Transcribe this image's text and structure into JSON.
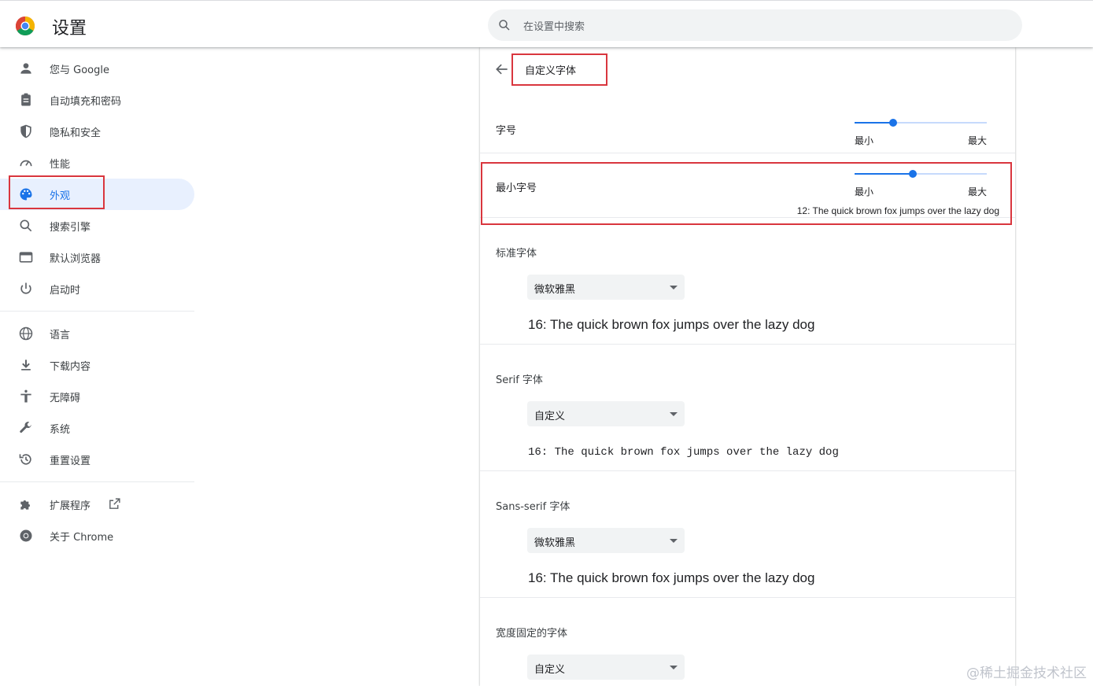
{
  "header": {
    "title": "设置",
    "search_placeholder": "在设置中搜索"
  },
  "sidebar": {
    "items": [
      {
        "label": "您与 Google",
        "icon": "person-icon"
      },
      {
        "label": "自动填充和密码",
        "icon": "clipboard-icon"
      },
      {
        "label": "隐私和安全",
        "icon": "shield-icon"
      },
      {
        "label": "性能",
        "icon": "speedometer-icon"
      },
      {
        "label": "外观",
        "icon": "palette-icon",
        "active": true
      },
      {
        "label": "搜索引擎",
        "icon": "search-icon"
      },
      {
        "label": "默认浏览器",
        "icon": "browser-window-icon"
      },
      {
        "label": "启动时",
        "icon": "power-icon"
      },
      {
        "label": "语言",
        "icon": "globe-icon"
      },
      {
        "label": "下载内容",
        "icon": "download-icon"
      },
      {
        "label": "无障碍",
        "icon": "accessibility-icon"
      },
      {
        "label": "系统",
        "icon": "wrench-icon"
      },
      {
        "label": "重置设置",
        "icon": "restore-icon"
      },
      {
        "label": "扩展程序",
        "icon": "puzzle-icon",
        "external": true
      },
      {
        "label": "关于 Chrome",
        "icon": "chrome-icon"
      }
    ]
  },
  "subpage": {
    "title": "自定义字体",
    "font_size": {
      "label": "字号",
      "min_label": "最小",
      "max_label": "最大",
      "value_fraction": 0.29
    },
    "min_font_size": {
      "label": "最小字号",
      "min_label": "最小",
      "max_label": "最大",
      "value_fraction": 0.44,
      "sample": "12: The quick brown fox jumps over the lazy dog"
    },
    "standard_font": {
      "label": "标准字体",
      "value": "微软雅黑",
      "sample": "16: The quick brown fox jumps over the lazy dog"
    },
    "serif_font": {
      "label": "Serif 字体",
      "value": "自定义",
      "sample": "16: The quick brown fox jumps over the lazy dog"
    },
    "sans_serif_font": {
      "label": "Sans-serif 字体",
      "value": "微软雅黑",
      "sample": "16: The quick brown fox jumps over the lazy dog"
    },
    "fixed_width_font": {
      "label": "宽度固定的字体",
      "value": "自定义"
    }
  },
  "watermark": "@稀土掘金技术社区",
  "colors": {
    "accent": "#1a73e8",
    "active_bg": "#e8f0fe",
    "highlight_box": "#d9363e"
  }
}
